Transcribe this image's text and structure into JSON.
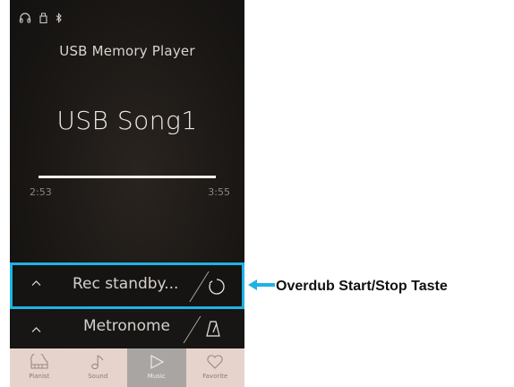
{
  "status_bar": {
    "icons": [
      "headphones-icon",
      "usb-icon",
      "bluetooth-icon"
    ]
  },
  "player": {
    "title": "USB Memory Player",
    "song": "USB Song1",
    "progress": 1.0,
    "elapsed": "2:53",
    "total": "3:55"
  },
  "rec_row": {
    "label": "Rec standby...",
    "chevron": "^",
    "action_icon": "overdub-circle-icon"
  },
  "metronome_row": {
    "label": "Metronome",
    "chevron": "^",
    "action_icon": "metronome-icon"
  },
  "nav": {
    "tabs": [
      {
        "label": "Pianist",
        "icon": "piano-icon",
        "active": false
      },
      {
        "label": "Sound",
        "icon": "music-note-icon",
        "active": false
      },
      {
        "label": "Music",
        "icon": "play-icon",
        "active": true
      },
      {
        "label": "Favorite",
        "icon": "heart-icon",
        "active": false
      }
    ]
  },
  "callout": {
    "label": "Overdub Start/Stop Taste",
    "color": "#1eb3e6"
  }
}
